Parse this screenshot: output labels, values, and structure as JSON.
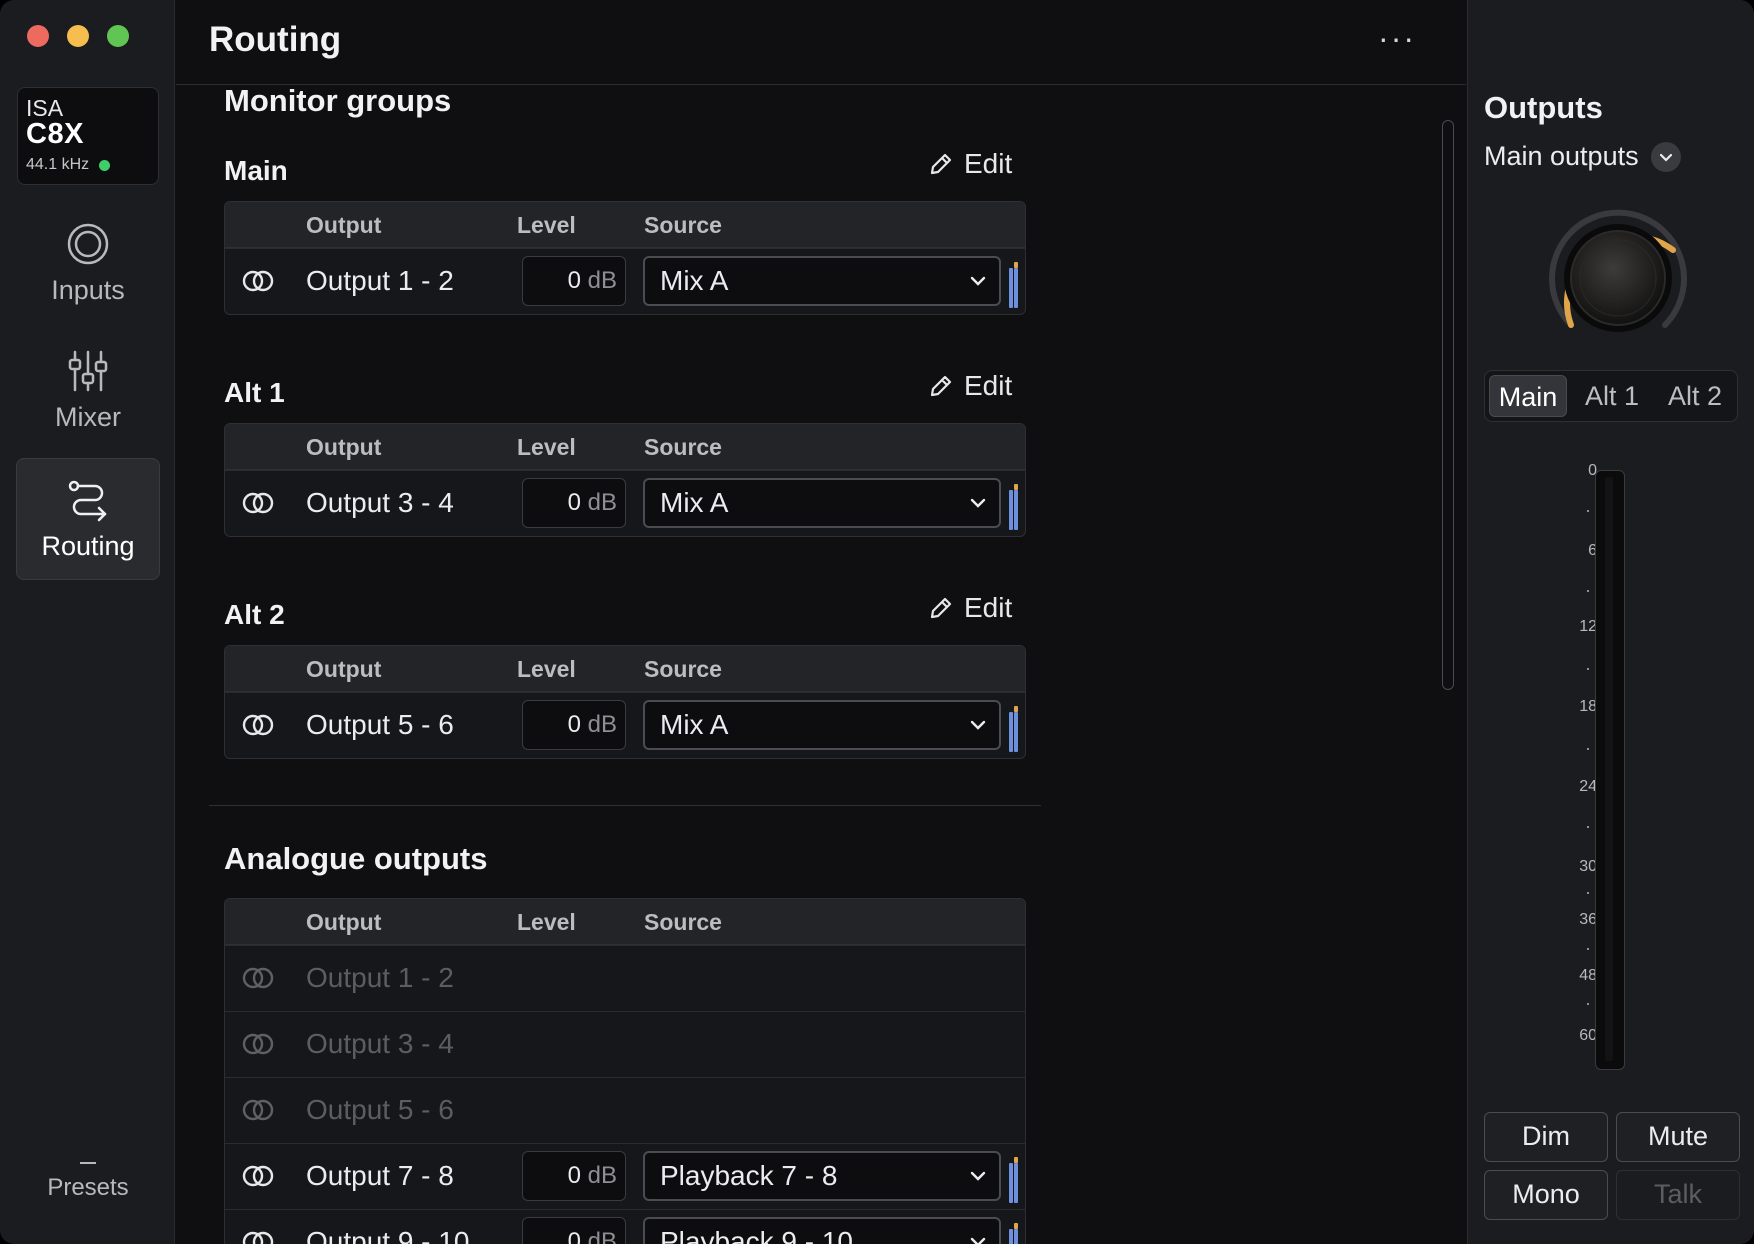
{
  "sidebar": {
    "device": {
      "brand": "ISA",
      "model": "C8X",
      "sample_rate": "44.1 kHz"
    },
    "nav": [
      {
        "label": "Inputs",
        "icon": "inputs-icon"
      },
      {
        "label": "Mixer",
        "icon": "mixer-icon"
      },
      {
        "label": "Routing",
        "icon": "routing-icon",
        "active": true
      }
    ],
    "presets": {
      "label": "Presets",
      "value": "–"
    }
  },
  "header": {
    "title": "Routing",
    "more_label": "···"
  },
  "monitor_groups": {
    "title": "Monitor groups",
    "edit_label": "Edit",
    "columns": {
      "output": "Output",
      "level": "Level",
      "source": "Source"
    },
    "groups": [
      {
        "name": "Main",
        "output": "Output 1 - 2",
        "level": "0",
        "unit": "dB",
        "source": "Mix A"
      },
      {
        "name": "Alt 1",
        "output": "Output 3 - 4",
        "level": "0",
        "unit": "dB",
        "source": "Mix A"
      },
      {
        "name": "Alt 2",
        "output": "Output 5 - 6",
        "level": "0",
        "unit": "dB",
        "source": "Mix A"
      }
    ]
  },
  "analogue_outputs": {
    "title": "Analogue outputs",
    "columns": {
      "output": "Output",
      "level": "Level",
      "source": "Source"
    },
    "rows": [
      {
        "output": "Output 1 - 2",
        "disabled": true
      },
      {
        "output": "Output 3 - 4",
        "disabled": true
      },
      {
        "output": "Output 5 - 6",
        "disabled": true
      },
      {
        "output": "Output 7 - 8",
        "level": "0",
        "unit": "dB",
        "source": "Playback 7 - 8"
      },
      {
        "output": "Output 9 - 10",
        "level": "0",
        "unit": "dB",
        "source": "Playback 9 - 10"
      }
    ]
  },
  "outputs_panel": {
    "title": "Outputs",
    "selector": "Main outputs",
    "segments": [
      "Main",
      "Alt 1",
      "Alt 2"
    ],
    "active_segment": "Main",
    "meter_scale": [
      "0",
      "6",
      "12",
      "18",
      "24",
      "30",
      "36",
      "48",
      "60"
    ],
    "buttons": {
      "dim": "Dim",
      "mute": "Mute",
      "mono": "Mono",
      "talk": "Talk"
    }
  },
  "colors": {
    "accent_knob": "#e0a54a",
    "meter_blue": "#6d8fdc",
    "meter_orange": "#e0a54a",
    "status_green": "#3fcf6a"
  }
}
